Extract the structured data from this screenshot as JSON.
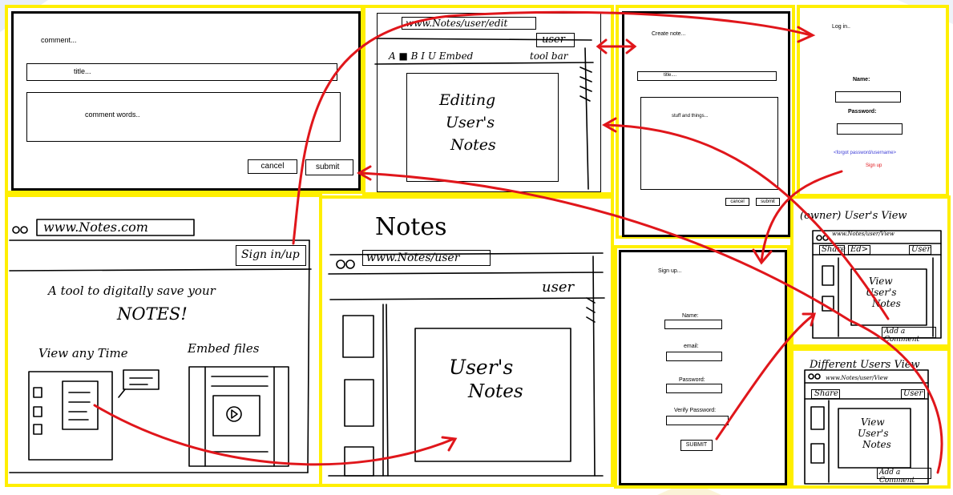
{
  "colors": {
    "frame": "#ffef00",
    "arrow": "#e0161b",
    "link": "#3b3bd6"
  },
  "comment_panel": {
    "heading": "comment...",
    "title_placeholder": "title...",
    "words_placeholder": "comment words..",
    "cancel": "cancel",
    "submit": "submit"
  },
  "edit_panel": {
    "url": "www.Notes/user/edit",
    "user": "user",
    "toolbar_items": "A ■ B I U  Embed",
    "toolbar_label": "tool bar",
    "editing_text": [
      "Editing",
      "User's",
      "Notes"
    ]
  },
  "create_panel": {
    "heading": "Create note...",
    "title_placeholder": "title....",
    "body_placeholder": "stuff and things...",
    "cancel": "cancel",
    "submit": "submit"
  },
  "login_panel": {
    "heading": "Log in..",
    "name_label": "Name:",
    "password_label": "Password:",
    "forgot": "<forgot password/username>",
    "signup": "Sign up"
  },
  "home_panel": {
    "url": "www.Notes.com",
    "signin": "Sign in/up",
    "tagline_1": "A tool to digitally save your",
    "tagline_2": "NOTES!",
    "feature_1": "View any Time",
    "feature_2": "Embed files"
  },
  "notes_panel": {
    "title": "Notes",
    "url": "www.Notes/user",
    "user": "user",
    "content_1": "User's",
    "content_2": "Notes"
  },
  "signup_panel": {
    "heading": "Sign up...",
    "name_label": "Name:",
    "email_label": "email:",
    "password_label": "Password:",
    "verify_label": "Verify Password:",
    "submit": "SUBMIT"
  },
  "owner_view": {
    "title": "(owner) User's View",
    "url": "www.Notes/user/View",
    "share": "Share",
    "edit": "Ed>",
    "user": "User",
    "content_1": "View",
    "content_2": "User's",
    "content_3": "Notes",
    "add_comment": "Add a Comment"
  },
  "other_view": {
    "title": "Different Users View",
    "url": "www.Notes/user/View",
    "share": "Share",
    "user": "User",
    "content_1": "View",
    "content_2": "User's",
    "content_3": "Notes",
    "add_comment": "Add a Comment"
  }
}
